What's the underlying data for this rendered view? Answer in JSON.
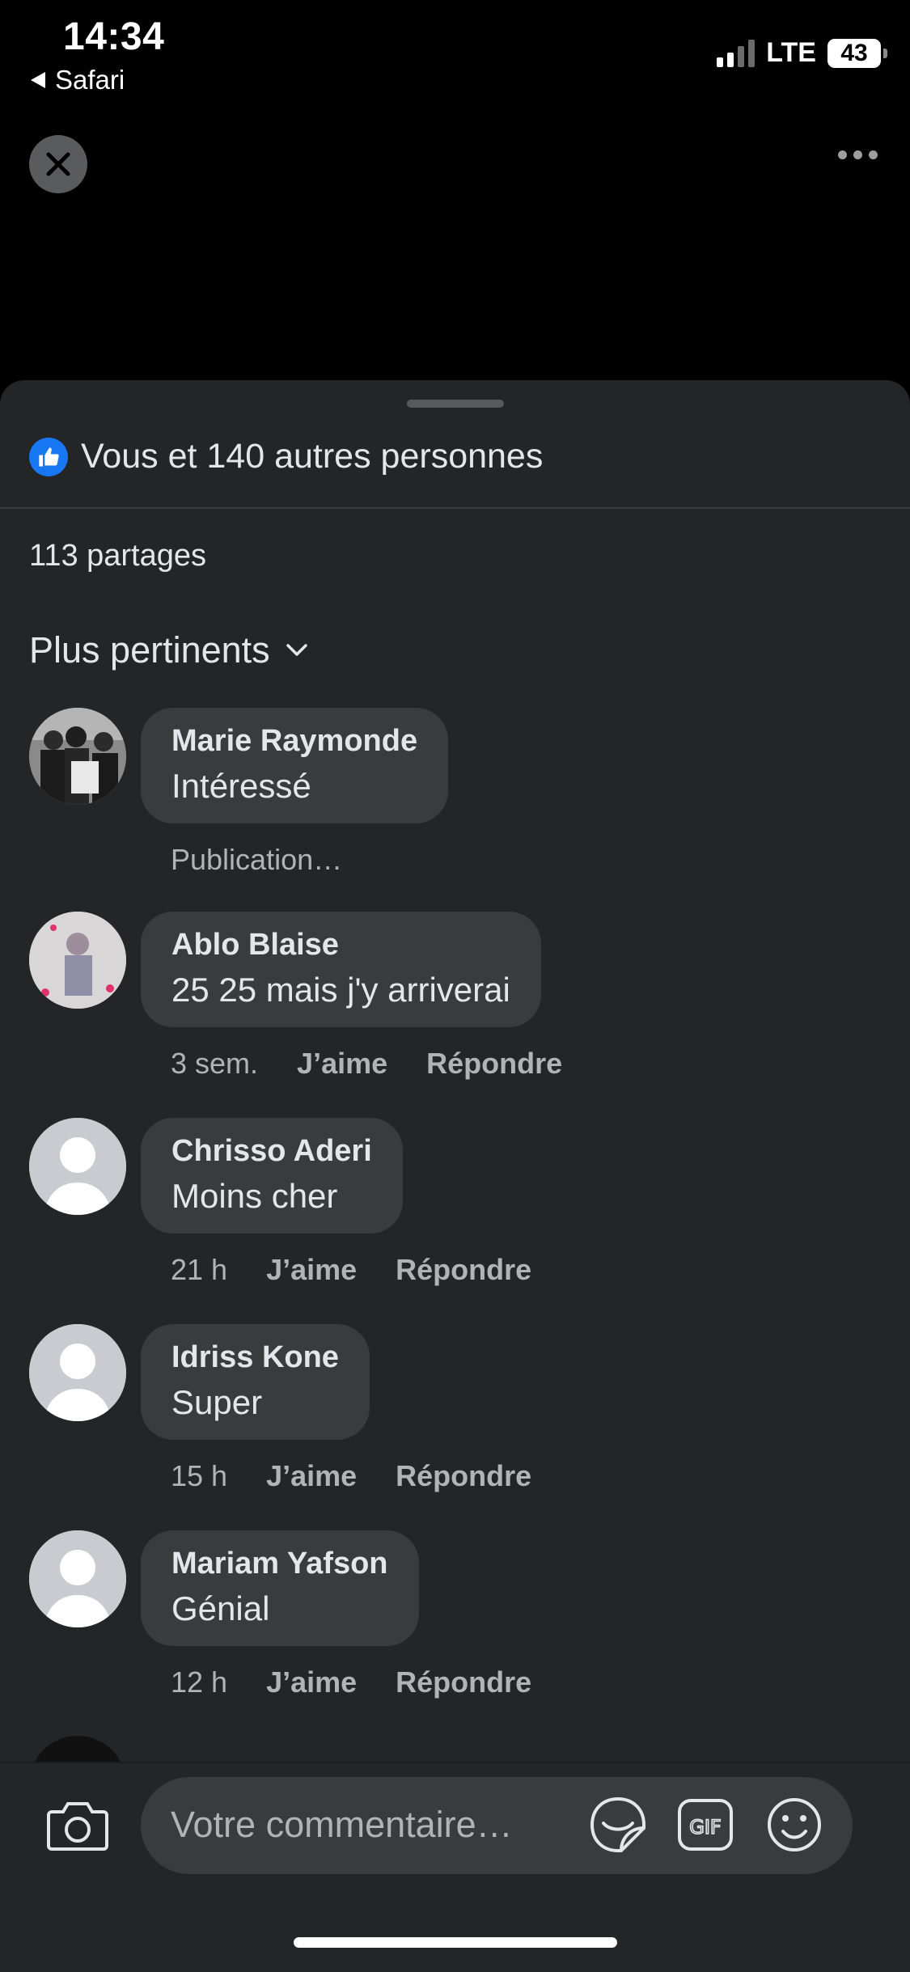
{
  "status_bar": {
    "time": "14:34",
    "back_app": "Safari",
    "network": "LTE",
    "battery": "43"
  },
  "header": {
    "close_icon": "close-icon",
    "more_icon": "more-horizontal-icon"
  },
  "reactions": {
    "likes_text": "Vous et 140 autres personnes",
    "shares_text": "113 partages",
    "like_color": "#1877f2"
  },
  "sort": {
    "label": "Plus pertinents"
  },
  "comments": [
    {
      "name": "Marie Raymonde",
      "text": "Intéressé",
      "status": "Publication…"
    },
    {
      "name": "Ablo Blaise",
      "text": "25 25 mais j'y arriverai",
      "time": "3 sem.",
      "like": "J’aime",
      "reply": "Répondre"
    },
    {
      "name": "Chrisso Aderi",
      "text": "Moins cher",
      "time": "21 h",
      "like": "J’aime",
      "reply": "Répondre"
    },
    {
      "name": "Idriss Kone",
      "text": "Super",
      "time": "15 h",
      "like": "J’aime",
      "reply": "Répondre"
    },
    {
      "name": "Mariam Yafson",
      "text": "Génial",
      "time": "12 h",
      "like": "J’aime",
      "reply": "Répondre"
    }
  ],
  "composer": {
    "placeholder": "Votre commentaire…",
    "gif_label": "GIF"
  }
}
